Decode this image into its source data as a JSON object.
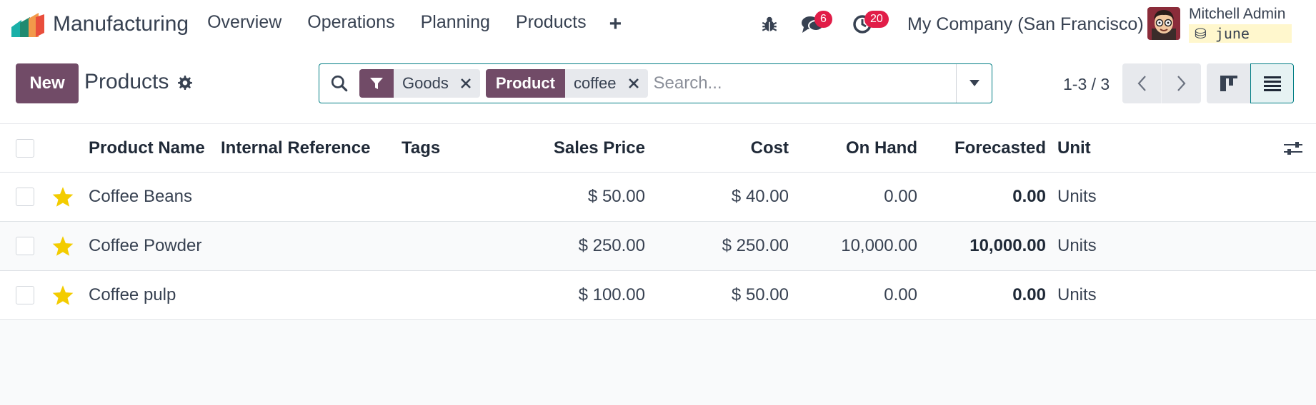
{
  "app": {
    "name": "Manufacturing"
  },
  "nav": {
    "items": [
      "Overview",
      "Operations",
      "Planning",
      "Products"
    ],
    "plus": "+"
  },
  "systray": {
    "messages_count": "6",
    "activities_count": "20",
    "company": "My Company (San Francisco)",
    "user_name": "Mitchell Admin",
    "database": "june"
  },
  "control": {
    "new_label": "New",
    "page_title": "Products",
    "pager": "1-3 / 3"
  },
  "search": {
    "facets": [
      {
        "type": "filter-icon",
        "value": "Goods"
      },
      {
        "label": "Product",
        "value": "coffee"
      }
    ],
    "placeholder": "Search..."
  },
  "table": {
    "columns": [
      "Product Name",
      "Internal Reference",
      "Tags",
      "Sales Price",
      "Cost",
      "On Hand",
      "Forecasted",
      "Unit"
    ],
    "rows": [
      {
        "favorite": true,
        "name": "Coffee Beans",
        "ref": "",
        "tags": "",
        "price": "$ 50.00",
        "cost": "$ 40.00",
        "on_hand": "0.00",
        "forecasted": "0.00",
        "unit": "Units"
      },
      {
        "favorite": true,
        "name": "Coffee Powder",
        "ref": "",
        "tags": "",
        "price": "$ 250.00",
        "cost": "$ 250.00",
        "on_hand": "10,000.00",
        "forecasted": "10,000.00",
        "unit": "Units"
      },
      {
        "favorite": true,
        "name": "Coffee pulp",
        "ref": "",
        "tags": "",
        "price": "$ 100.00",
        "cost": "$ 50.00",
        "on_hand": "0.00",
        "forecasted": "0.00",
        "unit": "Units"
      }
    ]
  },
  "colors": {
    "brand": "#714b67",
    "accent": "#017e84",
    "badge": "#e11d48",
    "star": "#f3cc00"
  },
  "icons": [
    "search-icon",
    "filter-icon",
    "close-icon",
    "gear-icon",
    "bug-icon",
    "chat-icon",
    "clock-icon",
    "database-icon",
    "chevron-left-icon",
    "chevron-right-icon",
    "kanban-view-icon",
    "list-view-icon",
    "optional-columns-icon",
    "star-icon"
  ]
}
